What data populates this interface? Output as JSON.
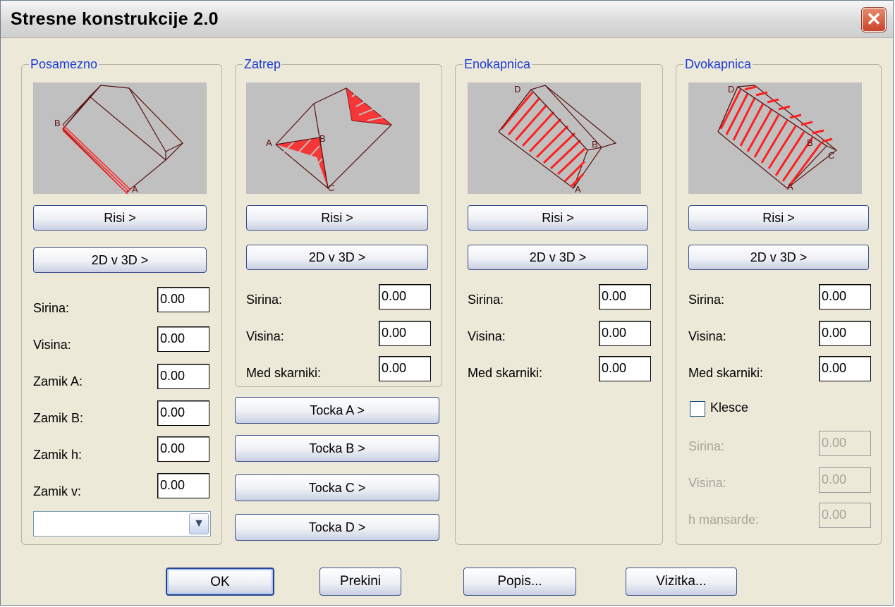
{
  "window": {
    "title": "Stresne konstrukcije 2.0",
    "close_glyph": "✕"
  },
  "groups": {
    "posamezno": {
      "legend": "Posamezno",
      "risi": "Risi >",
      "to3d": "2D v 3D >",
      "fields": [
        {
          "label": "Sirina:",
          "value": "0.00"
        },
        {
          "label": "Visina:",
          "value": "0.00"
        },
        {
          "label": "Zamik A:",
          "value": "0.00"
        },
        {
          "label": "Zamik B:",
          "value": "0.00"
        },
        {
          "label": "Zamik h:",
          "value": "0.00"
        },
        {
          "label": "Zamik v:",
          "value": "0.00"
        }
      ],
      "combo_value": "",
      "labels": {
        "a": "A",
        "b": "B"
      }
    },
    "zatrep": {
      "legend": "Zatrep",
      "risi": "Risi >",
      "to3d": "2D v 3D >",
      "fields": [
        {
          "label": "Sirina:",
          "value": "0.00"
        },
        {
          "label": "Visina:",
          "value": "0.00"
        },
        {
          "label": "Med skarniki:",
          "value": "0.00"
        }
      ],
      "tocke": [
        "Tocka A >",
        "Tocka B >",
        "Tocka C >",
        "Tocka D >"
      ],
      "labels": {
        "a": "A",
        "b": "B",
        "c": "C"
      }
    },
    "enokapnica": {
      "legend": "Enokapnica",
      "risi": "Risi >",
      "to3d": "2D v 3D >",
      "fields": [
        {
          "label": "Sirina:",
          "value": "0.00"
        },
        {
          "label": "Visina:",
          "value": "0.00"
        },
        {
          "label": "Med skarniki:",
          "value": "0.00"
        }
      ],
      "labels": {
        "a": "A",
        "b": "B",
        "d": "D"
      }
    },
    "dvokapnica": {
      "legend": "Dvokapnica",
      "risi": "Risi >",
      "to3d": "2D v 3D >",
      "fields": [
        {
          "label": "Sirina:",
          "value": "0.00"
        },
        {
          "label": "Visina:",
          "value": "0.00"
        },
        {
          "label": "Med skarniki:",
          "value": "0.00"
        }
      ],
      "klesce": {
        "label": "Klesce",
        "checked": false
      },
      "klesce_fields": [
        {
          "label": "Sirina:",
          "value": "0.00"
        },
        {
          "label": "Visina:",
          "value": "0.00"
        },
        {
          "label": "h mansarde:",
          "value": "0.00"
        }
      ],
      "labels": {
        "a": "A",
        "b": "B",
        "c": "C",
        "d": "D"
      }
    }
  },
  "footer": {
    "ok": "OK",
    "prekini": "Prekini",
    "popis": "Popis...",
    "vizitka": "Vizitka..."
  },
  "colors": {
    "accent": "#1a3bd6",
    "roof_line": "#5a1010",
    "hatch": "#ff2020",
    "preview_bg": "#c0c0c0"
  },
  "icons": {
    "close": "close-icon",
    "dropdown": "chevron-down-icon"
  }
}
